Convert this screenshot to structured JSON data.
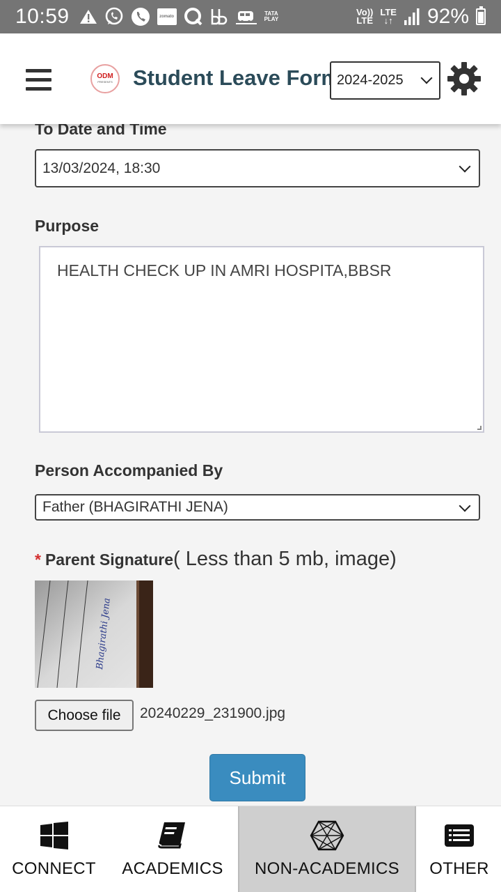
{
  "status_bar": {
    "time": "10:59",
    "battery": "92%",
    "battery_level": 0.92,
    "network_top": "Vo))",
    "network_bottom": "LTE",
    "lte_label": "LTE",
    "icons": [
      "warning-icon",
      "whatsapp-icon",
      "phone-icon",
      "zomato-icon",
      "q-icon",
      "bb-icon",
      "train-icon",
      "tataplay-icon",
      "signal-icon",
      "battery-icon"
    ],
    "zomato_text": "zomato",
    "tataplay_top": "TATA",
    "tataplay_bottom": "PLAY"
  },
  "header": {
    "title": "Student Leave Form",
    "logo_top": "ODM",
    "logo_bottom": "PRESENTS",
    "year_selected": "2024-2025"
  },
  "form": {
    "to_date_label": "To Date and Time",
    "to_date_value": "13/03/2024, 18:30",
    "purpose_label": "Purpose",
    "purpose_value": "HEALTH CHECK UP IN AMRI HOSPITA,BBSR",
    "accompanied_label": "Person Accompanied By",
    "accompanied_value": "Father (BHAGIRATHI JENA)",
    "signature_required_mark": "*",
    "signature_label": "Parent Signature",
    "signature_hint": "( Less than 5 mb, image)",
    "signature_text": "Bhagirathi Jena",
    "choose_file_label": "Choose file",
    "file_name": "20240229_231900.jpg",
    "submit_label": "Submit"
  },
  "bottom_nav": {
    "items": [
      {
        "label": "CONNECT",
        "icon": "windows-icon",
        "active": false
      },
      {
        "label": "ACADEMICS",
        "icon": "book-icon",
        "active": false
      },
      {
        "label": "NON-ACADEMICS",
        "icon": "hexagon-icon",
        "active": true
      },
      {
        "label": "OTHER",
        "icon": "list-icon",
        "active": false
      }
    ]
  },
  "colors": {
    "status_bar": "#757575",
    "title": "#2b4b59",
    "submit": "#3a8cbf",
    "required": "#d32f2f",
    "active_nav": "#cfcfcf"
  }
}
